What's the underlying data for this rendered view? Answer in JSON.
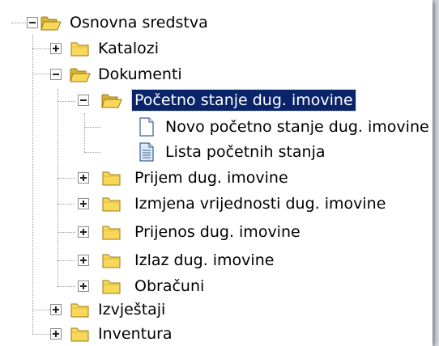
{
  "tree": {
    "root": {
      "label": "Osnovna sredstva",
      "icon": "folder-open-icon",
      "state": "expanded"
    },
    "katalozi": {
      "label": "Katalozi",
      "icon": "folder-icon",
      "state": "collapsed"
    },
    "dokumenti": {
      "label": "Dokumenti",
      "icon": "folder-open-icon",
      "state": "expanded"
    },
    "pocetno": {
      "label": "Početno stanje dug. imovine",
      "icon": "folder-open-icon",
      "state": "expanded",
      "selected": true
    },
    "novo": {
      "label": "Novo početno stanje dug. imovine",
      "icon": "new-document-icon"
    },
    "lista": {
      "label": "Lista početnih stanja",
      "icon": "list-document-icon"
    },
    "prijem": {
      "label": "Prijem dug. imovine",
      "icon": "folder-icon",
      "state": "collapsed"
    },
    "izmjena": {
      "label": "Izmjena vrijednosti dug. imovine",
      "icon": "folder-icon",
      "state": "collapsed"
    },
    "prijenos": {
      "label": "Prijenos dug. imovine",
      "icon": "folder-icon",
      "state": "collapsed"
    },
    "izlaz": {
      "label": "Izlaz dug. imovine",
      "icon": "folder-icon",
      "state": "collapsed"
    },
    "obracuni": {
      "label": "Obračuni",
      "icon": "folder-icon",
      "state": "collapsed"
    },
    "izvjestaji": {
      "label": "Izvještaji",
      "icon": "folder-icon",
      "state": "collapsed"
    },
    "inventura": {
      "label": "Inventura",
      "icon": "folder-icon",
      "state": "collapsed"
    }
  },
  "colors": {
    "selection_bg": "#0a246a",
    "selection_text": "#ffffff",
    "folder_fill": "#f8d85a",
    "connector": "#9a9a9a"
  }
}
